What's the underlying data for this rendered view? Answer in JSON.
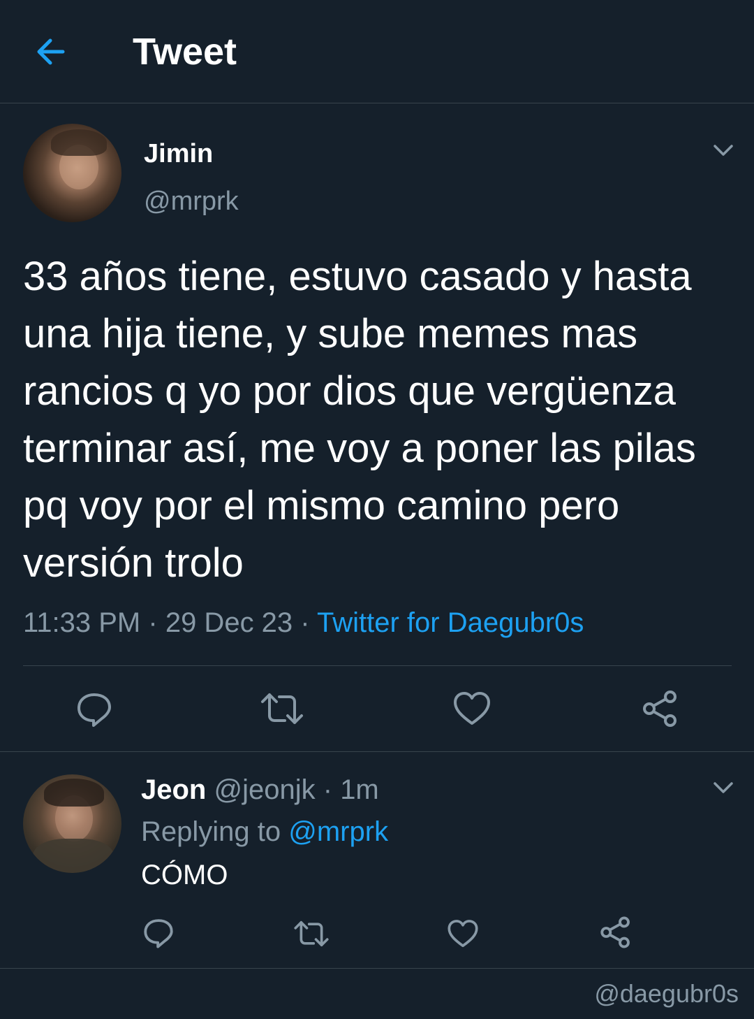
{
  "header": {
    "title": "Tweet",
    "back_icon": "arrow-left-icon"
  },
  "tweet": {
    "author_name": "Jimin",
    "author_handle": "@mrprk",
    "text": "33 años tiene, estuvo casado y hasta una hija tiene, y sube memes mas rancios q yo por dios que vergüenza terminar así, me voy a poner las pilas pq voy por el mismo camino pero versión trolo",
    "time": "11:33 PM",
    "separator": "·",
    "date": "29 Dec 23",
    "source": "Twitter for Daegubr0s"
  },
  "reply": {
    "author_name": "Jeon",
    "author_handle": "@jeonjk",
    "separator": "·",
    "age": "1m",
    "replying_prefix": "Replying to",
    "replying_to": "@mrprk",
    "text": "CÓMO"
  },
  "watermark": "@daegubr0s",
  "colors": {
    "background": "#15202b",
    "divider": "#38444d",
    "muted": "#8899a6",
    "accent": "#1da1f2",
    "text": "#ffffff"
  },
  "icons": [
    "arrow-left-icon",
    "chevron-down-icon",
    "reply-icon",
    "retweet-icon",
    "like-icon",
    "share-icon"
  ]
}
